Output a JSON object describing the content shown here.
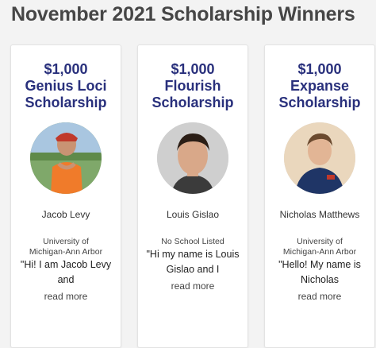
{
  "page": {
    "title": "November 2021 Scholarship Winners"
  },
  "cards": [
    {
      "amount": "$1,000",
      "scholarship": "Genius Loci Scholarship",
      "winner": "Jacob Levy",
      "school": "University of Michigan-Ann Arbor",
      "quote": "\"Hi! I am Jacob Levy and",
      "read_more": "read more",
      "photo_icon": "winner-photo"
    },
    {
      "amount": "$1,000",
      "scholarship": "Flourish Scholarship",
      "winner": "Louis Gislao",
      "school": "No School Listed",
      "quote": "\"Hi my name is Louis Gislao and I",
      "read_more": "read more",
      "photo_icon": "winner-photo"
    },
    {
      "amount": "$1,000",
      "scholarship": "Expanse Scholarship",
      "winner": "Nicholas Matthews",
      "school": "University of Michigan-Ann Arbor",
      "quote": "\"Hello! My name is Nicholas",
      "read_more": "read more",
      "photo_icon": "winner-photo"
    }
  ],
  "colors": {
    "heading": "#29307c",
    "title": "#464646",
    "background": "#f3f3f3"
  }
}
